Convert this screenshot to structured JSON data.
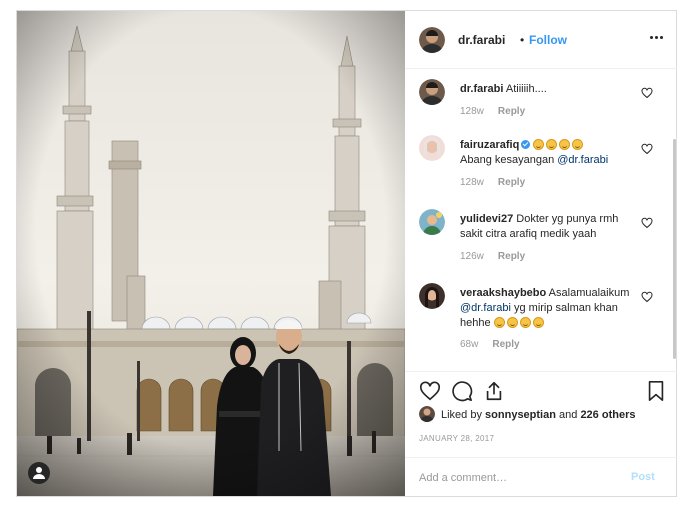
{
  "post": {
    "author": {
      "username": "dr.farabi",
      "separator": "•",
      "follow_label": "Follow",
      "avatar_icon": "avatar-photo"
    },
    "comments": [
      {
        "username": "dr.farabi",
        "verified": false,
        "text": "Atiiiiih....",
        "age": "128w",
        "reply_label": "Reply"
      },
      {
        "username": "fairuzarafiq",
        "verified": true,
        "emoji_count": 4,
        "text": "Abang kesayangan",
        "mention": "@dr.farabi",
        "age": "128w",
        "reply_label": "Reply"
      },
      {
        "username": "yulidevi27",
        "verified": false,
        "text": "Dokter yg punya rmh sakit citra arafiq medik yaah",
        "age": "126w",
        "reply_label": "Reply"
      },
      {
        "username": "veraakshaybebo",
        "verified": false,
        "text_before": "Asalamualaikum",
        "mention": "@dr.farabi",
        "text": "yg mirip salman khan hehhe",
        "emoji_count": 4,
        "age": "68w",
        "reply_label": "Reply"
      }
    ],
    "actions": {
      "like_icon": "heart-icon",
      "comment_icon": "comment-icon",
      "share_icon": "share-icon",
      "save_icon": "bookmark-icon"
    },
    "likes": {
      "user": "sonnyseptian",
      "connector": "Liked by",
      "and_text": "and",
      "others": "226 others"
    },
    "date": "JANUARY 28, 2017",
    "add_comment": {
      "placeholder": "Add a comment…",
      "post_label": "Post"
    },
    "colors": {
      "link_blue": "#3897f0",
      "post_disabled": "#b2dffc",
      "meta_gray": "#999999"
    }
  }
}
